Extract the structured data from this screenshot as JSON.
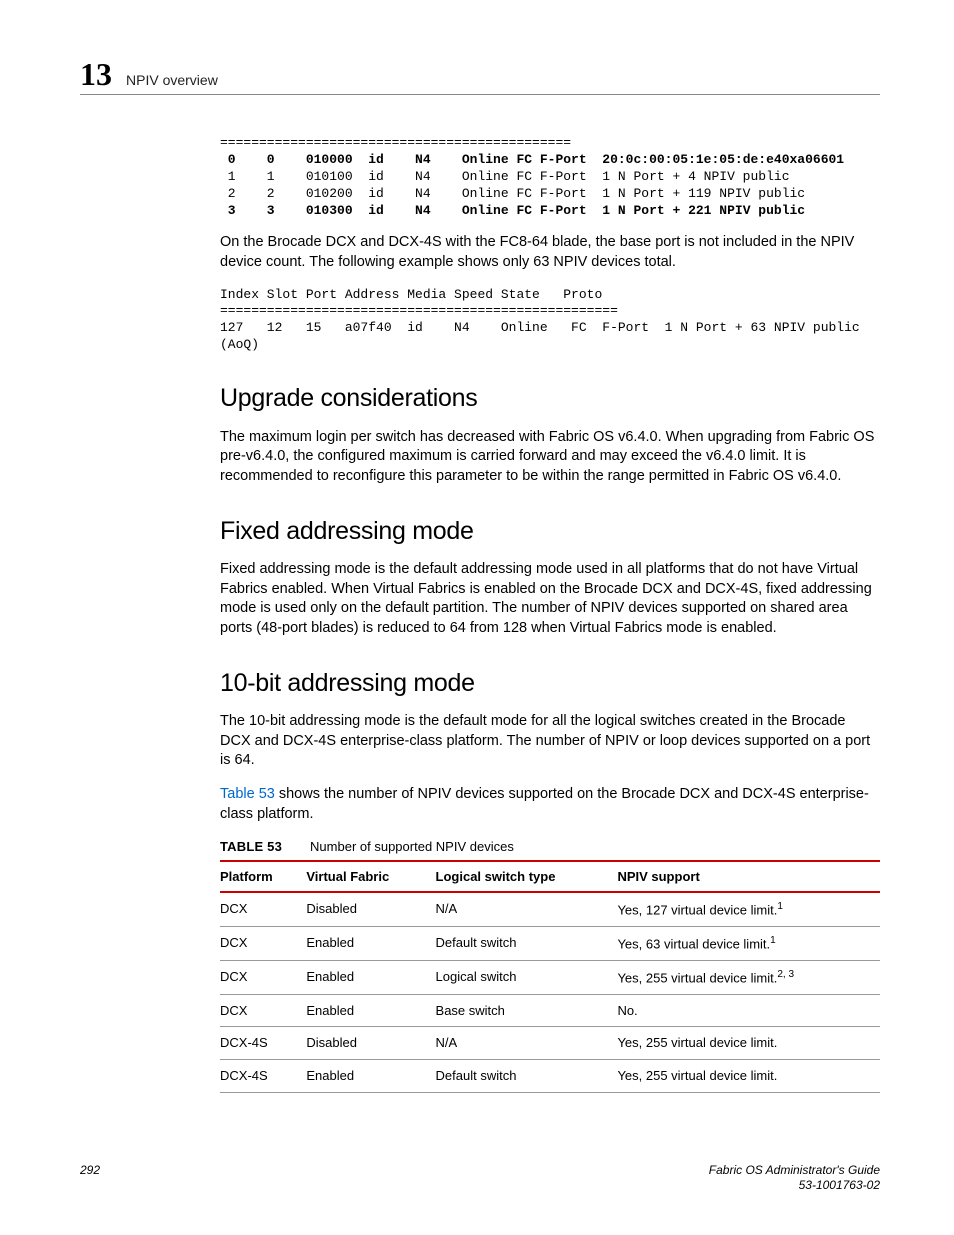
{
  "header": {
    "chapter_number": "13",
    "section_title": "NPIV overview"
  },
  "code1": {
    "rule": "=============================================",
    "l1a": " 0    0    010000  id    N4    ",
    "l1b": "Online FC F-Port  20:0c:00:05:1e:05:de:e40xa06601",
    "l2": " 1    1    010100  id    N4    Online FC F-Port  1 N Port + 4 NPIV public",
    "l3": " 2    2    010200  id    N4    Online FC F-Port  1 N Port + 119 NPIV public",
    "l4a": " 3    3    010300  id    N4    ",
    "l4b": "Online FC F-Port  1 N Port + 221 NPIV public"
  },
  "para1": "On the Brocade DCX and DCX-4S with the FC8-64 blade, the base port is not included in the NPIV device count. The following example shows only 63 NPIV devices total.",
  "code2": {
    "l1": "Index Slot Port Address Media Speed State   Proto",
    "l2": "===================================================",
    "l3": "127   12   15   a07f40  id    N4    Online   FC  F-Port  1 N Port + 63 NPIV public",
    "l4": "(AoQ)"
  },
  "sect1": {
    "title": "Upgrade considerations",
    "body": "The maximum login per switch has decreased with Fabric OS v6.4.0. When upgrading from Fabric OS pre-v6.4.0, the configured maximum is carried forward and may exceed the v6.4.0 limit. It is recommended to reconfigure this parameter to be within the range permitted in Fabric OS v6.4.0."
  },
  "sect2": {
    "title": "Fixed addressing mode",
    "body": "Fixed addressing mode is the default addressing mode used in all platforms that do not have Virtual Fabrics enabled. When Virtual Fabrics is enabled on the Brocade DCX and DCX-4S, fixed addressing mode is used only on the default partition. The number of NPIV devices supported on shared area ports (48-port blades) is reduced to 64 from 128 when Virtual Fabrics mode is enabled."
  },
  "sect3": {
    "title": "10-bit addressing mode",
    "body1": "The 10-bit addressing mode is the default mode for all the logical switches created in the Brocade DCX and DCX-4S enterprise-class platform. The number of NPIV or loop devices supported on a port is 64.",
    "body2a": "Table 53",
    "body2b": " shows the number of NPIV devices supported on the Brocade DCX and DCX-4S enterprise-class platform."
  },
  "table": {
    "label": "TABLE 53",
    "title": "Number of supported NPIV devices",
    "headers": [
      "Platform",
      "Virtual Fabric",
      "Logical switch type",
      "NPIV support"
    ],
    "rows": [
      [
        "DCX",
        "Disabled",
        "N/A",
        "Yes, 127 virtual device limit.",
        "1"
      ],
      [
        "DCX",
        "Enabled",
        "Default switch",
        "Yes, 63 virtual device limit.",
        "1"
      ],
      [
        "DCX",
        "Enabled",
        "Logical switch",
        "Yes, 255 virtual device limit.",
        "2, 3"
      ],
      [
        "DCX",
        "Enabled",
        "Base switch",
        "No.",
        ""
      ],
      [
        "DCX-4S",
        "Disabled",
        "N/A",
        "Yes, 255 virtual device limit.",
        ""
      ],
      [
        "DCX-4S",
        "Enabled",
        "Default switch",
        "Yes, 255 virtual device limit.",
        ""
      ]
    ]
  },
  "footer": {
    "page": "292",
    "doc_title": "Fabric OS Administrator's Guide",
    "doc_num": "53-1001763-02"
  }
}
